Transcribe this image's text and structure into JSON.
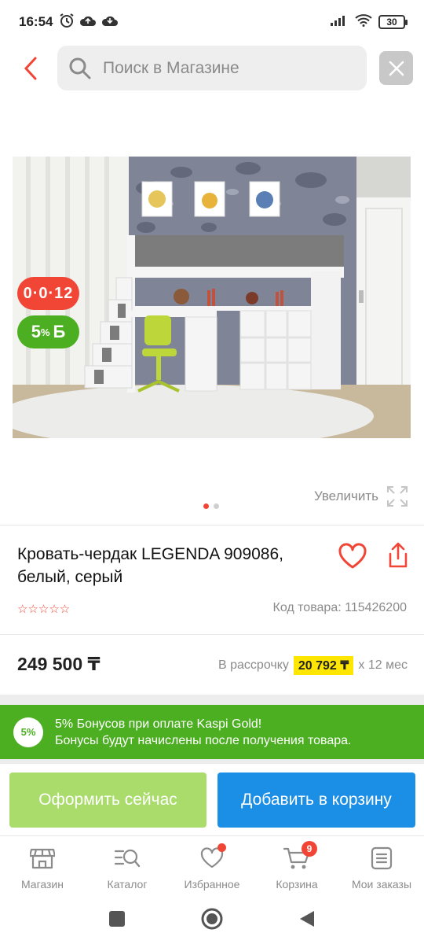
{
  "status_bar": {
    "time": "16:54",
    "battery": "30"
  },
  "search": {
    "placeholder": "Поиск в Магазине"
  },
  "product": {
    "timer_badge": "0·0·12",
    "bonus_badge_percent": "5",
    "bonus_badge_symbol": "%",
    "bonus_badge_letter": "Б",
    "zoom_label": "Увеличить",
    "title": "Кровать-чердак LEGENDA 909086, белый, серый",
    "rating_stars": "☆☆☆☆☆",
    "sku": "Код товара: 115426200",
    "price": "249 500 ₸",
    "installment_prefix": "В рассрочку",
    "installment_amount": "20 792 ₸",
    "installment_suffix": "x 12 мес"
  },
  "promo": {
    "badge": "5%",
    "line1": "5% Бонусов при оплате Kaspi Gold!",
    "line2": "Бонусы будут начислены после получения товара."
  },
  "actions": {
    "buy_now": "Оформить сейчас",
    "add_to_cart": "Добавить в корзину"
  },
  "bottom_nav": {
    "shop": "Магазин",
    "catalog": "Каталог",
    "favorites": "Избранное",
    "cart": "Корзина",
    "cart_count": "9",
    "orders": "Мои заказы"
  },
  "colors": {
    "accent_red": "#f14635",
    "kaspi_green": "#4caf22",
    "buy_green": "#a9dc6b",
    "cart_blue": "#1b8ee6",
    "installment_yellow": "#ffe600"
  }
}
